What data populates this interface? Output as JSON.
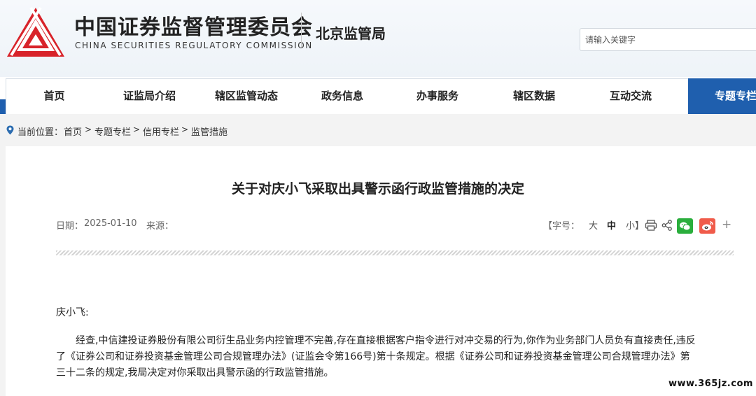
{
  "header": {
    "brand_cn": "中国证券监督管理委员会",
    "brand_en": "CHINA SECURITIES REGULATORY COMMISSION",
    "bureau": "北京监管局",
    "search_placeholder": "请输入关键字"
  },
  "nav": {
    "items": [
      "首页",
      "证监局介绍",
      "辖区监管动态",
      "政务信息",
      "办事服务",
      "辖区数据",
      "互动交流",
      "专题专栏"
    ],
    "active_index": 7,
    "active_color": "#1f5fae"
  },
  "breadcrumb": {
    "prefix": "当前位置：",
    "items": [
      "首页",
      "专题专栏",
      "信用专栏",
      "监管措施"
    ],
    "separator": ">"
  },
  "article": {
    "title": "关于对庆小飞采取出具警示函行政监管措施的决定",
    "date_label": "日期：",
    "date_value": "2025-01-10",
    "source_label": "来源：",
    "font_label": "【字号：",
    "font_large": "大",
    "font_medium": "中",
    "font_small": "小】",
    "more": "+",
    "greeting": "庆小飞:",
    "para1_line1": "经查,中信建投证券股份有限公司衍生品业务内控管理不完善,存在直接根据客户指令进行对冲交易的行为,你作为业务部门人员负有直接责任,违反",
    "para1_line2": "了《证券公司和证券投资基金管理公司合规管理办法》(证监会令第166号)第十条规定。根据《证券公司和证券投资基金管理公司合规管理办法》第",
    "para1_line3": "三十二条的规定,我局决定对你采取出具警示函的行政监管措施。"
  },
  "watermark": "www.365jz.com"
}
